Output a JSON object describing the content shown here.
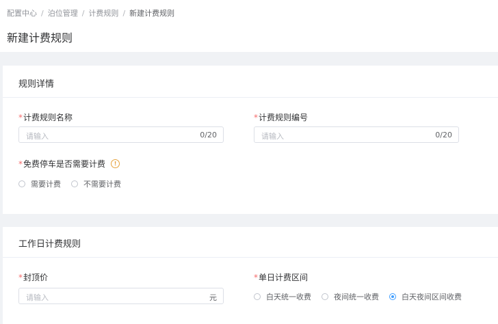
{
  "breadcrumb": [
    {
      "label": "配置中心"
    },
    {
      "label": "泊位管理"
    },
    {
      "label": "计费规则"
    },
    {
      "label": "新建计费规则"
    }
  ],
  "breadcrumb_separator": "/",
  "page_title": "新建计费规则",
  "rule_detail": {
    "section_title": "规则详情",
    "required_mark": "*",
    "name_field": {
      "label": "计费规则名称",
      "placeholder": "请输入",
      "counter": "0/20"
    },
    "code_field": {
      "label": "计费规则编号",
      "placeholder": "请输入",
      "counter": "0/20"
    },
    "free_parking": {
      "label": "免费停车是否需要计费",
      "info_icon": "info-icon",
      "options": [
        "需要计费",
        "不需要计费"
      ],
      "selected": null
    }
  },
  "workday_rule": {
    "section_title": "工作日计费规则",
    "required_mark": "*",
    "cap_price": {
      "label": "封顶价",
      "placeholder": "请输入",
      "unit": "元"
    },
    "billing_interval": {
      "label": "单日计费区间",
      "options": [
        "白天统一收费",
        "夜间统一收费",
        "白天夜间区间收费"
      ],
      "selected": "白天夜间区间收费"
    }
  },
  "colors": {
    "accent": "#409eff",
    "required": "#f56c6c",
    "warning_icon": "#e6a23c",
    "background": "#f0f2f5"
  }
}
